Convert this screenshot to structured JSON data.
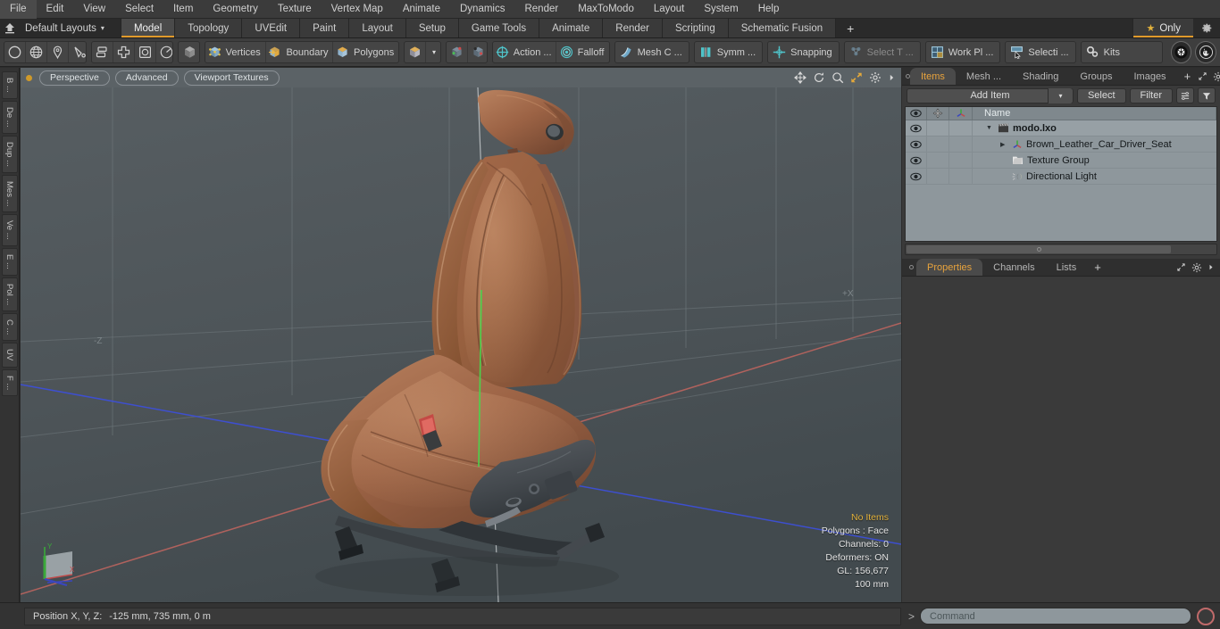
{
  "menubar": {
    "items": [
      "File",
      "Edit",
      "View",
      "Select",
      "Item",
      "Geometry",
      "Texture",
      "Vertex Map",
      "Animate",
      "Dynamics",
      "Render",
      "MaxToModo",
      "Layout",
      "System",
      "Help"
    ]
  },
  "layoutbar": {
    "home_icon": "home-up-icon",
    "layout_selector": "Default Layouts",
    "caret": "▾",
    "tabs": [
      "Model",
      "Topology",
      "UVEdit",
      "Paint",
      "Layout",
      "Setup",
      "Game Tools",
      "Animate",
      "Render",
      "Scripting",
      "Schematic Fusion"
    ],
    "active_tab": "Model",
    "add_tab": "+",
    "only_label": "Only",
    "only_star": "★",
    "gear_icon": "gear-icon"
  },
  "toolbar": {
    "group_primitives": [
      {
        "name": "circle-tool",
        "icon": "circle-icon"
      },
      {
        "name": "sphere-tool",
        "icon": "globe-icon"
      },
      {
        "name": "pen-tool",
        "icon": "pen-icon"
      },
      {
        "name": "curve-tool",
        "icon": "curve-icon"
      }
    ],
    "group_transform": [
      {
        "name": "align-tool",
        "icon": "align-icon"
      },
      {
        "name": "center-tool",
        "icon": "crosshair-box-icon"
      },
      {
        "name": "bounds-tool",
        "icon": "rounded-square-icon"
      },
      {
        "name": "radial-tool",
        "icon": "clock-icon"
      }
    ],
    "group_item_mode": [
      {
        "name": "item-mode",
        "icon": "grey-cube-icon"
      }
    ],
    "selection_modes": [
      {
        "label": "Vertices",
        "icon": "vertices-cube-icon"
      },
      {
        "label": "Boundary",
        "icon": "boundary-cube-icon"
      },
      {
        "label": "Polygons",
        "icon": "polygons-cube-icon"
      }
    ],
    "mesh_cube": {
      "name": "mesh-cube-dropdown",
      "icon": "gold-cube-icon",
      "caret": "▾"
    },
    "snap_cubes": [
      {
        "name": "vertex-snap-a",
        "icon": "snap-cube-a-icon"
      },
      {
        "name": "vertex-snap-b",
        "icon": "snap-cube-b-icon"
      }
    ],
    "buttons": [
      {
        "label": "Action   ...",
        "icon": "action-center-icon",
        "name": "action-center-button",
        "dim": false
      },
      {
        "label": "Falloff",
        "icon": "falloff-icon",
        "name": "falloff-button",
        "dim": false
      },
      {
        "label": "Mesh C ...",
        "icon": "mesh-constraint-icon",
        "name": "mesh-constraint-button",
        "dim": false
      },
      {
        "label": "Symm ...",
        "icon": "symmetry-icon",
        "name": "symmetry-button",
        "dim": false
      },
      {
        "label": "Snapping",
        "icon": "snapping-icon",
        "name": "snapping-button",
        "dim": false
      },
      {
        "label": "Select T ...",
        "icon": "select-through-icon",
        "name": "select-through-button",
        "dim": true
      },
      {
        "label": "Work Pl ...",
        "icon": "work-plane-icon",
        "name": "work-plane-button",
        "dim": false
      },
      {
        "label": "Selecti ...",
        "icon": "selection-set-icon",
        "name": "selection-set-button",
        "dim": false
      }
    ],
    "kits": {
      "label": "Kits",
      "icon": "kits-gears-icon"
    },
    "unity": {
      "name": "unity-icon"
    },
    "unreal": {
      "name": "unreal-icon"
    }
  },
  "left_tabs": [
    "B ...",
    "De ...",
    "Dup ...",
    "Mes ...",
    "Ve ...",
    "E ...",
    "Pol ...",
    "C ...",
    "UV",
    "F ..."
  ],
  "viewport": {
    "header_buttons": [
      "Perspective",
      "Advanced",
      "Viewport Textures"
    ],
    "nav_icons": [
      "pan-icon",
      "rotate-icon",
      "zoom-icon",
      "fit-icon",
      "gear-icon",
      "arrow-right-icon"
    ],
    "axis_labels": {
      "z_neg": "-Z",
      "x_pos": "+X"
    },
    "stats": {
      "title": "No Items",
      "polygons": "Polygons : Face",
      "channels": "Channels: 0",
      "deformers": "Deformers: ON",
      "gl": "GL: 156,677",
      "scale": "100 mm"
    },
    "gizmo": {
      "x": "X",
      "y": "Y",
      "z": "Z"
    },
    "model": {
      "leather_color": "#9a6247",
      "leather_dark": "#6d4330",
      "leather_light": "#b9805f",
      "plastic_color": "#4a4e52",
      "buckle_color": "#d4534e"
    },
    "colors": {
      "bg_top": "#565d61",
      "bg_bottom": "#434a4e",
      "grid": "#6d767a",
      "axis_x": "#b05a5a",
      "axis_z": "#3f4fd0",
      "axis_y": "#46c24a"
    }
  },
  "right_panel": {
    "top_tabs": [
      "Items",
      "Mesh ...",
      "Shading",
      "Groups",
      "Images"
    ],
    "top_active": "Items",
    "top_extras": [
      "+",
      "expand-icon",
      "gear-icon",
      "arrow-right-icon"
    ],
    "add_item": "Add Item",
    "add_item_caret": "▾",
    "select_button": "Select",
    "filter_button": "Filter",
    "list_icons": [
      "list-options-icon",
      "filter-funnel-icon"
    ],
    "columns": {
      "eye": "eye-icon",
      "lock": "move-lock-icon",
      "axis": "axis-icon",
      "name": "Name"
    },
    "rows": [
      {
        "label": "modo.lxo",
        "icon": "scene-clapper-icon",
        "indent": 0,
        "bold": true,
        "expander": "▼",
        "selected": true
      },
      {
        "label": "Brown_Leather_Car_Driver_Seat",
        "icon": "mesh-axis-icon",
        "indent": 1,
        "bold": false,
        "expander": "▶",
        "selected": false
      },
      {
        "label": "Texture Group",
        "icon": "texture-group-icon",
        "indent": 1,
        "bold": false,
        "expander": "",
        "selected": false
      },
      {
        "label": "Directional Light",
        "icon": "directional-light-icon",
        "indent": 1,
        "bold": false,
        "expander": "",
        "selected": false
      }
    ],
    "bottom_tabs": [
      "Properties",
      "Channels",
      "Lists"
    ],
    "bottom_active": "Properties",
    "bottom_plus": "+",
    "bottom_extras": [
      "expand-icon",
      "gear-icon",
      "arrow-right-icon"
    ]
  },
  "bottom_bar": {
    "status_label": "Position X, Y, Z:",
    "status_value": "-125 mm, 735 mm, 0 m",
    "command_arrow": ">",
    "command_placeholder": "Command",
    "command_value": "",
    "record_icon": "record-circle-icon"
  },
  "accent": {
    "orange": "#e09a2b",
    "gold": "#e3b23c",
    "cyan": "#4fc3c9"
  }
}
